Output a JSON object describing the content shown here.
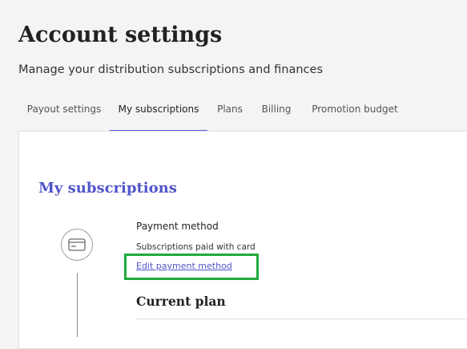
{
  "header": {
    "title": "Account settings",
    "subtitle": "Manage your distribution subscriptions and finances"
  },
  "tabs": [
    {
      "label": "Payout settings",
      "active": false
    },
    {
      "label": "My subscriptions",
      "active": true
    },
    {
      "label": "Plans",
      "active": false
    },
    {
      "label": "Billing",
      "active": false
    },
    {
      "label": "Promotion budget",
      "active": false
    }
  ],
  "subscriptions": {
    "section_title": "My subscriptions",
    "payment_method_label": "Payment method",
    "payment_method_detail": "Subscriptions paid with card",
    "edit_link": "Edit payment method",
    "current_plan_title": "Current plan"
  },
  "colors": {
    "accent": "#4f55c9",
    "highlight": "#1faa3e"
  },
  "icons": {
    "payment": "credit-card-icon"
  }
}
